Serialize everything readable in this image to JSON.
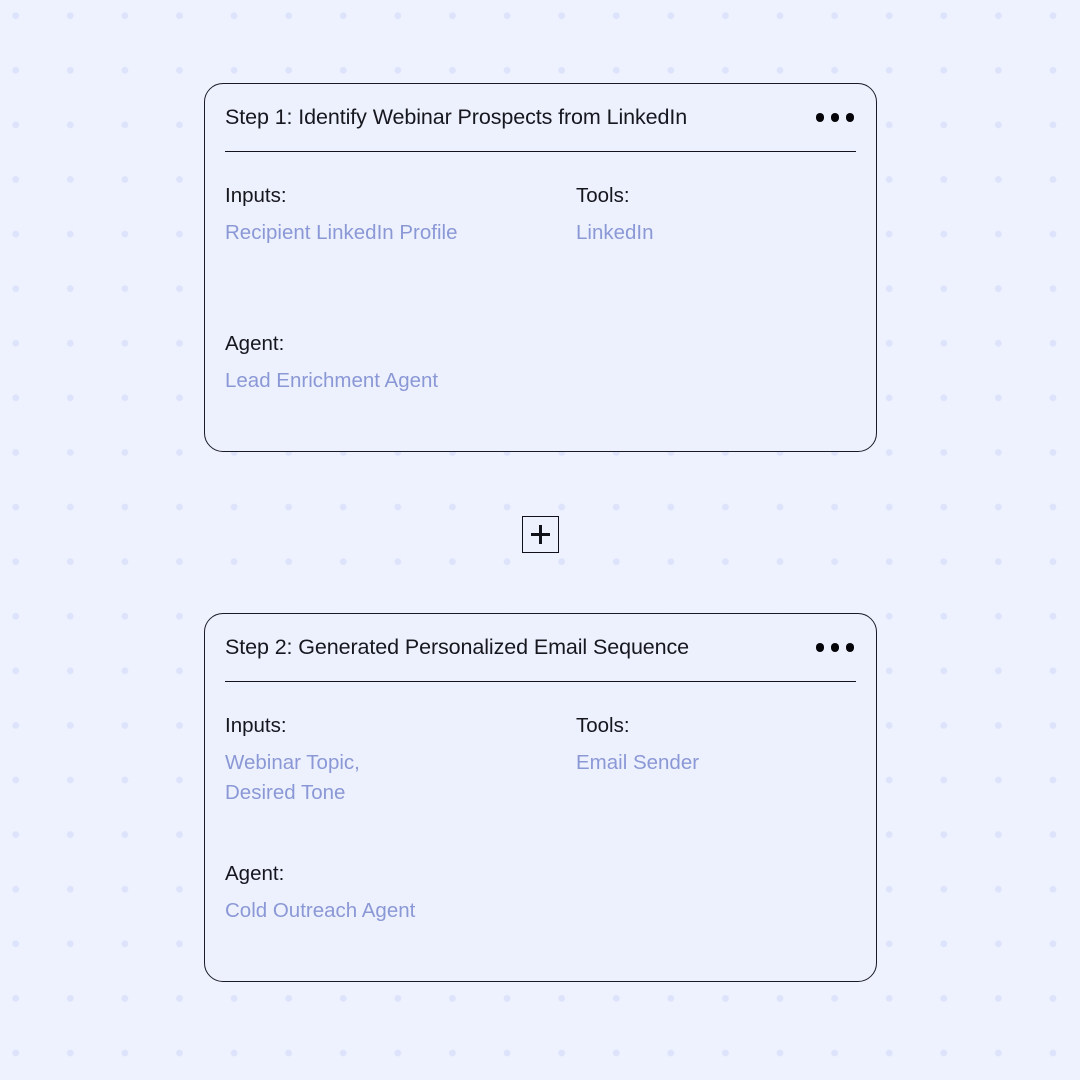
{
  "canvas": {
    "background_color": "#eef2fe",
    "dot_color": "#dde3fb",
    "dot_spacing_px": 55
  },
  "colors": {
    "card_background": "#edf1fd",
    "card_border": "#1b1b28",
    "title_text": "#17171f",
    "label_text": "#16161e",
    "value_text": "#8b98d6",
    "menu_dot": "#050509"
  },
  "steps": [
    {
      "id": "step-1",
      "title": "Step 1: Identify Webinar Prospects from LinkedIn",
      "menu_icon": "ellipsis-horizontal-icon",
      "inputs_label": "Inputs:",
      "inputs_value": "Recipient LinkedIn Profile",
      "tools_label": "Tools:",
      "tools_value": "LinkedIn",
      "agent_label": "Agent:",
      "agent_value": "Lead Enrichment Agent"
    },
    {
      "id": "step-2",
      "title": "Step 2: Generated Personalized Email Sequence",
      "menu_icon": "ellipsis-horizontal-icon",
      "inputs_label": "Inputs:",
      "inputs_value": "Webinar Topic,\nDesired Tone",
      "tools_label": "Tools:",
      "tools_value": "Email Sender",
      "agent_label": "Agent:",
      "agent_value": "Cold Outreach Agent"
    }
  ],
  "add_step": {
    "icon": "plus-icon",
    "label": "+"
  }
}
